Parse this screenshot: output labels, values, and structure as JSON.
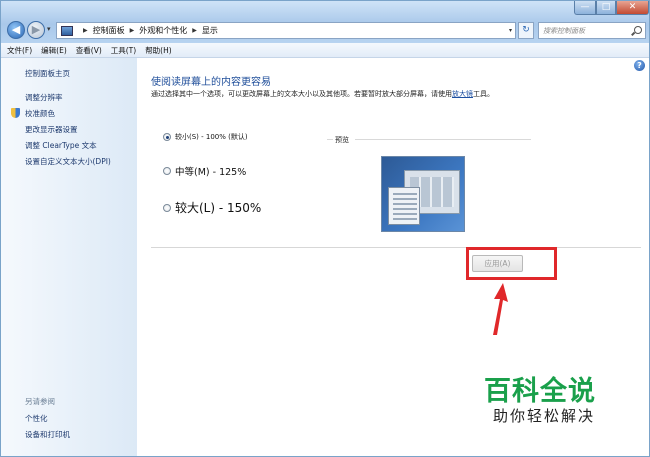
{
  "window": {
    "min": "—",
    "max": "□",
    "close": "✕"
  },
  "nav": {
    "back": "◀",
    "forward": "▶",
    "dropdown": "▾"
  },
  "breadcrumb": [
    "控制面板",
    "外观和个性化",
    "显示"
  ],
  "breadcrumb_sep": "▶",
  "address_dropdown": "▾",
  "refresh": "↻",
  "search": {
    "placeholder": "搜索控制面板"
  },
  "menu": [
    "文件(F)",
    "编辑(E)",
    "查看(V)",
    "工具(T)",
    "帮助(H)"
  ],
  "sidebar": {
    "home": "控制面板主页",
    "links": [
      "调整分辨率",
      "校准颜色",
      "更改显示器设置",
      "调整 ClearType 文本",
      "设置自定义文本大小(DPI)"
    ],
    "see_also_title": "另请参阅",
    "see_also": [
      "个性化",
      "设备和打印机"
    ]
  },
  "main": {
    "help": "?",
    "heading": "使阅读屏幕上的内容更容易",
    "description": "通过选择其中一个选项，可以更改屏幕上的文本大小以及其他项。若要暂时放大部分屏幕，请使用",
    "description_link": "放大镜",
    "description_end": "工具。",
    "options": [
      {
        "label": "较小(S) - 100% (默认)",
        "selected": true
      },
      {
        "label": "中等(M) - 125%",
        "selected": false
      },
      {
        "label": "较大(L) - 150%",
        "selected": false
      }
    ],
    "preview_label": "预览",
    "apply_button": "应用(A)"
  },
  "colors": {
    "highlight": "#e0282a",
    "watermark": "#1aa04b"
  },
  "watermark": {
    "title": "百科全说",
    "subtitle": "助你轻松解决"
  }
}
